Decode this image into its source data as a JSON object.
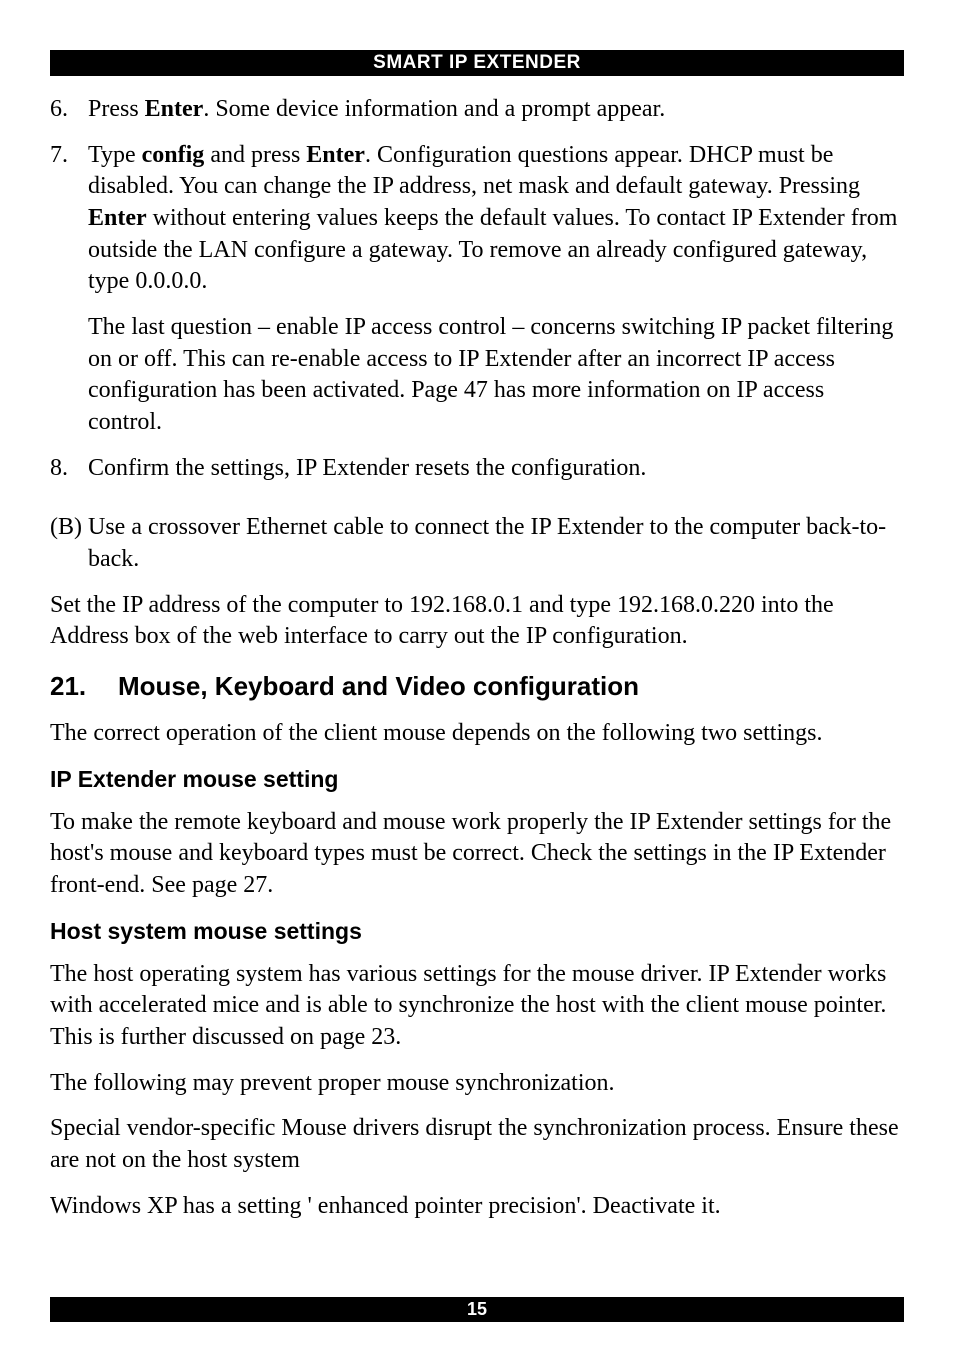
{
  "header": "SMART IP EXTENDER",
  "footer": "15",
  "items": [
    {
      "num": "6.",
      "pre": "Press ",
      "bold1": "Enter",
      "rest": ". Some device information and a prompt appear."
    },
    {
      "num": "7.",
      "pre": "Type ",
      "bold1": "config",
      "mid1": " and press ",
      "bold2": "Enter",
      "mid2": ". Configuration questions appear. DHCP must be disabled. You can change the IP address, net mask and default gateway. Pressing ",
      "bold3": "Enter",
      "rest": " without entering values keeps the default values. To contact IP Extender from outside the LAN configure a gateway. To remove an already configured gateway, type 0.0.0.0.",
      "sub": "The last question – enable IP access control – concerns switching IP packet filtering on or off. This can re-enable access to IP Extender after an incorrect IP access configuration has been activated. Page 47 has more information on IP access control."
    },
    {
      "num": "8.",
      "pre": "",
      "rest": "Confirm the settings, IP Extender resets the configuration."
    }
  ],
  "b_item": "(B) Use a crossover Ethernet cable to connect the IP Extender to the computer back-to-back.",
  "para_after_b": "Set the IP address of the computer to 192.168.0.1 and type 192.168.0.220 into the Address box of the web interface to carry out the IP configuration.",
  "h2_num": "21.",
  "h2_text": "Mouse, Keyboard and Video configuration",
  "para_h2": "The correct operation of the client mouse depends on the following two settings.",
  "h3_1": "IP Extender mouse setting",
  "para_h3_1": "To make the remote keyboard and mouse work properly the IP Extender settings for the host's mouse and keyboard types must be correct. Check the settings in the IP Extender front-end. See page 27.",
  "h3_2": "Host system mouse settings",
  "para_h3_2a": "The host operating system has various settings for the mouse driver. IP Extender works with accelerated mice and is able to synchronize the host with the client mouse pointer. This is further discussed on page 23.",
  "para_h3_2b": "The following may prevent proper mouse synchronization.",
  "para_h3_2c": "Special vendor-specific Mouse drivers disrupt the synchronization process. Ensure these are not on the host system",
  "para_h3_2d": "Windows XP has a setting ' enhanced pointer precision'. Deactivate it."
}
